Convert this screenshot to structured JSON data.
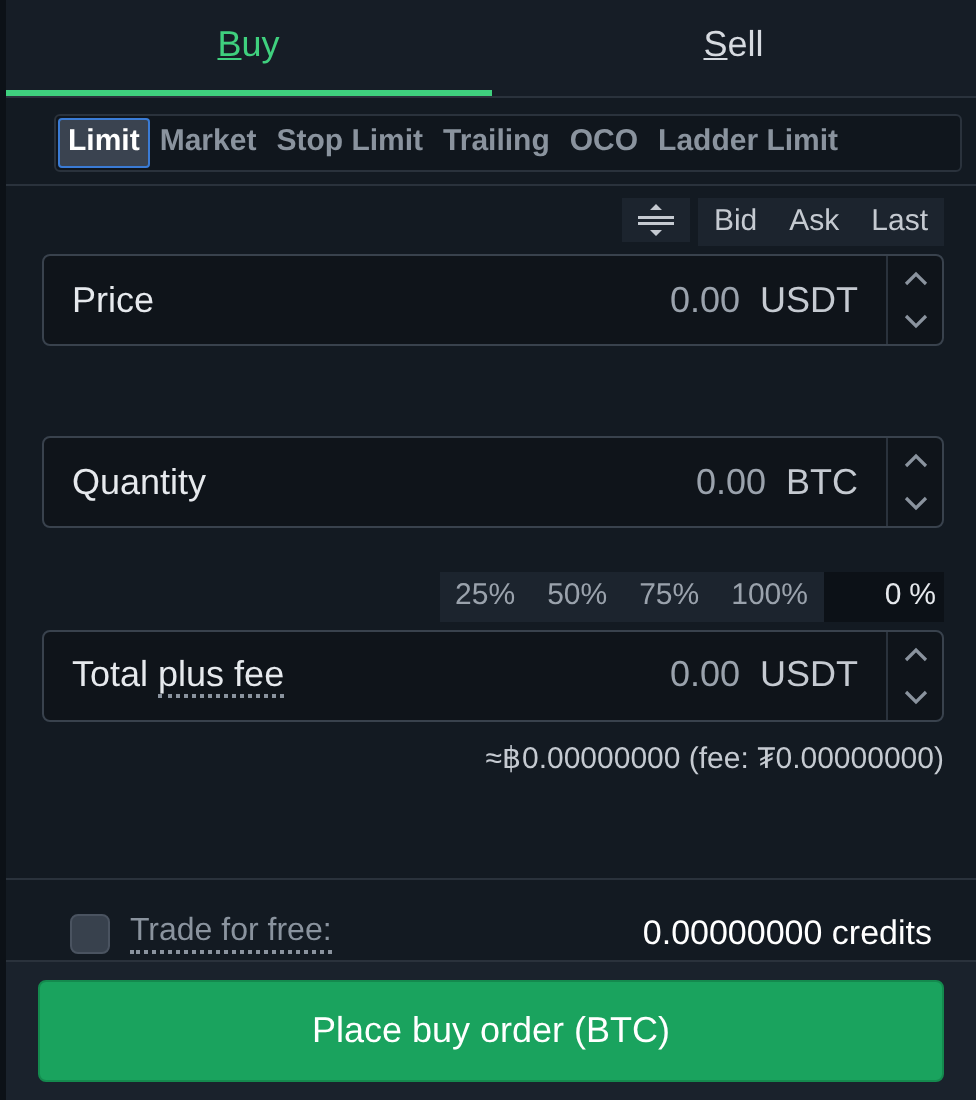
{
  "side_tabs": [
    {
      "label": "Buy",
      "mnemonic": true,
      "selected": true
    },
    {
      "label": "Sell",
      "mnemonic": true,
      "selected": false
    }
  ],
  "order_types": [
    {
      "label": "Limit",
      "selected": true
    },
    {
      "label": "Market",
      "selected": false
    },
    {
      "label": "Stop Limit",
      "selected": false
    },
    {
      "label": "Trailing",
      "selected": false
    },
    {
      "label": "OCO",
      "selected": false
    },
    {
      "label": "Ladder Limit",
      "selected": false
    }
  ],
  "price_sources": [
    "Bid",
    "Ask",
    "Last"
  ],
  "fields": [
    {
      "label": "Price",
      "value": "0.00",
      "unit": "USDT"
    },
    {
      "label": "Quantity",
      "value": "0.00",
      "unit": "BTC"
    },
    {
      "label": "Total",
      "hint_label": "plus fee",
      "value": "0.00",
      "unit": "USDT"
    }
  ],
  "percent_buttons": [
    "25%",
    "50%",
    "75%",
    "100%"
  ],
  "percent_input": {
    "value": "0",
    "unit": "%"
  },
  "fee_note": "≈฿0.00000000 (fee: ₮0.00000000)",
  "free_trade": {
    "label": "Trade for free:",
    "checked": false,
    "amount": "0.00000000",
    "amount_unit": "credits"
  },
  "submit": "Place buy order (BTC)"
}
